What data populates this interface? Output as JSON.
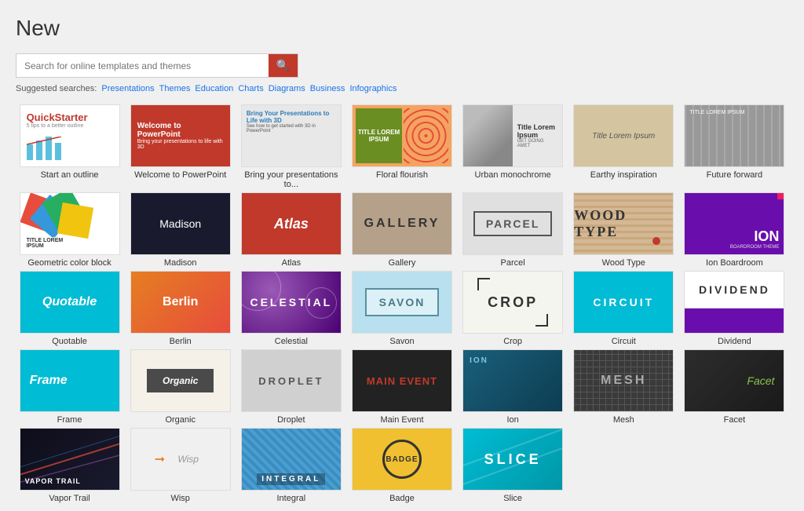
{
  "page": {
    "title": "New"
  },
  "search": {
    "placeholder": "Search for online templates and themes",
    "button_icon": "🔍"
  },
  "suggested": {
    "label": "Suggested searches:",
    "links": [
      "Presentations",
      "Themes",
      "Education",
      "Charts",
      "Diagrams",
      "Business",
      "Infographics"
    ]
  },
  "templates": [
    {
      "id": "quickstarter",
      "label": "Start an outline",
      "type": "quickstarter"
    },
    {
      "id": "welcome",
      "label": "Welcome to PowerPoint",
      "type": "welcome"
    },
    {
      "id": "bring",
      "label": "Bring your presentations to...",
      "type": "bring"
    },
    {
      "id": "floral",
      "label": "Floral flourish",
      "type": "floral"
    },
    {
      "id": "urban",
      "label": "Urban monochrome",
      "type": "urban"
    },
    {
      "id": "earthy",
      "label": "Earthy inspiration",
      "type": "earthy"
    },
    {
      "id": "future",
      "label": "Future forward",
      "type": "future"
    },
    {
      "id": "geometric",
      "label": "Geometric color block",
      "type": "geometric"
    },
    {
      "id": "madison",
      "label": "Madison",
      "type": "madison"
    },
    {
      "id": "atlas",
      "label": "Atlas",
      "type": "atlas"
    },
    {
      "id": "gallery",
      "label": "Gallery",
      "type": "gallery"
    },
    {
      "id": "parcel",
      "label": "Parcel",
      "type": "parcel"
    },
    {
      "id": "woodtype",
      "label": "Wood Type",
      "type": "woodtype"
    },
    {
      "id": "ion",
      "label": "Ion Boardroom",
      "type": "ion"
    },
    {
      "id": "quotable",
      "label": "Quotable",
      "type": "quotable"
    },
    {
      "id": "berlin",
      "label": "Berlin",
      "type": "berlin"
    },
    {
      "id": "celestial",
      "label": "Celestial",
      "type": "celestial"
    },
    {
      "id": "savon",
      "label": "Savon",
      "type": "savon"
    },
    {
      "id": "crop",
      "label": "Crop",
      "type": "crop"
    },
    {
      "id": "circuit",
      "label": "Circuit",
      "type": "circuit"
    },
    {
      "id": "dividend",
      "label": "Dividend",
      "type": "dividend"
    },
    {
      "id": "frame",
      "label": "Frame",
      "type": "frame"
    },
    {
      "id": "organic",
      "label": "Organic",
      "type": "organic"
    },
    {
      "id": "droplet",
      "label": "Droplet",
      "type": "droplet"
    },
    {
      "id": "mainevent",
      "label": "Main Event",
      "type": "mainevent"
    },
    {
      "id": "ion2",
      "label": "Ion",
      "type": "ion2"
    },
    {
      "id": "mesh",
      "label": "Mesh",
      "type": "mesh"
    },
    {
      "id": "facet",
      "label": "Facet",
      "type": "facet"
    },
    {
      "id": "vaportrail",
      "label": "Vapor Trail",
      "type": "vaportrail"
    },
    {
      "id": "wisp",
      "label": "Wisp",
      "type": "wisp"
    },
    {
      "id": "integral",
      "label": "Integral",
      "type": "integral"
    },
    {
      "id": "badge",
      "label": "Badge",
      "type": "badge"
    },
    {
      "id": "slice",
      "label": "Slice",
      "type": "slice"
    }
  ]
}
